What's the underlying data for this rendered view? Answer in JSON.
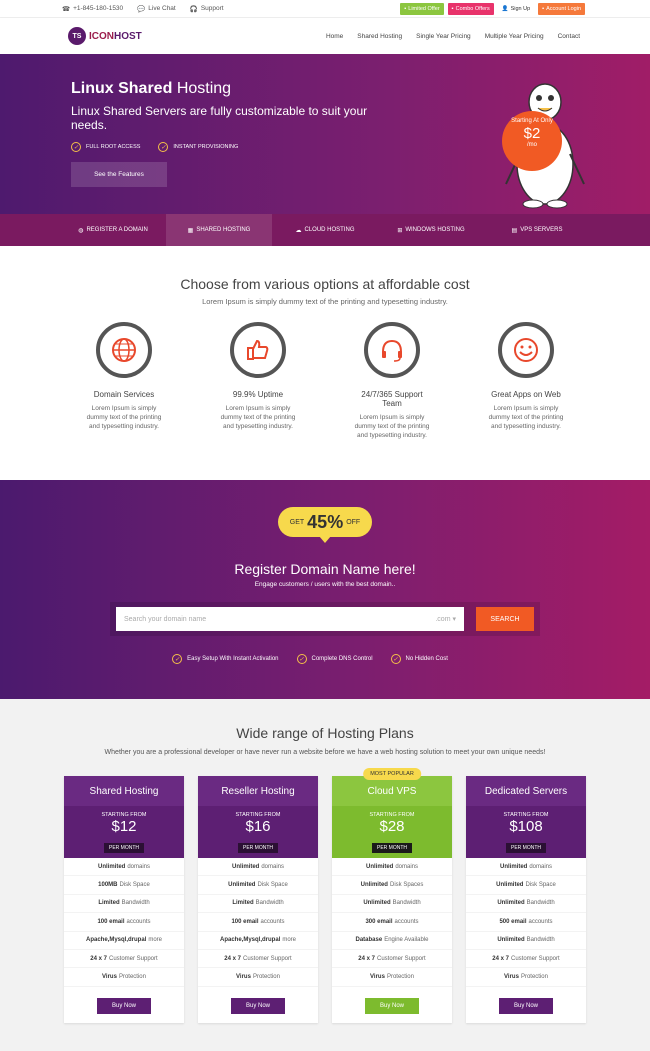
{
  "topbar": {
    "phone": "+1-845-180-1530",
    "chat": "Live Chat",
    "support": "Support",
    "buttons": [
      {
        "label": "Limited Offer",
        "color": "#8cc63f"
      },
      {
        "label": "Combo Offers",
        "color": "#e8336b"
      },
      {
        "label": "Sign Up",
        "color": "#ffffff"
      },
      {
        "label": "Account Login",
        "color": "#f5793b"
      }
    ]
  },
  "nav": {
    "logo_badge": "TS",
    "logo_a": "ICON",
    "logo_b": "HOST",
    "items": [
      "Home",
      "Shared Hosting",
      "Single Year Pricing",
      "Multiple Year Pricing",
      "Contact"
    ]
  },
  "hero": {
    "title_bold": "Linux Shared",
    "title_rest": "Hosting",
    "subtitle": "Linux Shared Servers are fully customizable to suit your needs.",
    "features": [
      "FULL ROOT ACCESS",
      "INSTANT PROVISIONING"
    ],
    "cta": "See the Features",
    "price_label": "Starting At Only",
    "price": "$2",
    "price_unit": "/mo"
  },
  "tabs": [
    {
      "label": "REGISTER A DOMAIN",
      "icon": "globe-icon"
    },
    {
      "label": "SHARED HOSTING",
      "icon": "grid-icon"
    },
    {
      "label": "CLOUD HOSTING",
      "icon": "cloud-icon"
    },
    {
      "label": "WINDOWS HOSTING",
      "icon": "windows-icon"
    },
    {
      "label": "VPS SERVERS",
      "icon": "server-icon"
    }
  ],
  "choose": {
    "title": "Choose from various options at affordable cost",
    "subtitle": "Lorem Ipsum is simply dummy text of the printing and typesetting industry.",
    "features": [
      {
        "title": "Domain Services",
        "icon": "globe-icon",
        "desc": "Lorem Ipsum is simply dummy text of the printing and typesetting industry."
      },
      {
        "title": "99.9% Uptime",
        "icon": "thumbs-up-icon",
        "desc": "Lorem Ipsum is simply dummy text of the printing and typesetting industry."
      },
      {
        "title": "24/7/365 Support Team",
        "icon": "headset-icon",
        "desc": "Lorem Ipsum is simply dummy text of the printing and typesetting industry."
      },
      {
        "title": "Great Apps on Web",
        "icon": "smiley-icon",
        "desc": "Lorem Ipsum is simply dummy text of the printing and typesetting industry."
      }
    ]
  },
  "domain": {
    "get": "GET",
    "percent": "45%",
    "off": "OFF",
    "title": "Register Domain Name here!",
    "subtitle": "Engage customers / users with the best domain..",
    "placeholder": "Search your domain name",
    "tld": ".com",
    "button": "SEARCH",
    "features": [
      "Easy Setup With Instant Activation",
      "Complete DNS Control",
      "No Hidden Cost"
    ]
  },
  "plans": {
    "title": "Wide range of Hosting Plans",
    "subtitle": "Whether you are a professional developer or have never run a website before we have a web hosting solution to meet your own unique needs!",
    "starting": "STARTING FROM",
    "per_month": "PER MONTH",
    "buy": "Buy Now",
    "popular": "MOST POPULAR",
    "cards": [
      {
        "name": "Shared Hosting",
        "price": "$12",
        "rows": [
          [
            "Unlimited",
            "domains"
          ],
          [
            "100MB",
            "Disk Space"
          ],
          [
            "Limited",
            "Bandwidth"
          ],
          [
            "100 email",
            "accounts"
          ],
          [
            "Apache,Mysql,drupal",
            "more"
          ],
          [
            "24 x 7",
            "Customer Support"
          ],
          [
            "Virus",
            "Protection"
          ]
        ]
      },
      {
        "name": "Reseller Hosting",
        "price": "$16",
        "rows": [
          [
            "Unlimited",
            "domains"
          ],
          [
            "Unlimited",
            "Disk Space"
          ],
          [
            "Limited",
            "Bandwidth"
          ],
          [
            "100 email",
            "accounts"
          ],
          [
            "Apache,Mysql,drupal",
            "more"
          ],
          [
            "24 x 7",
            "Customer Support"
          ],
          [
            "Virus",
            "Protection"
          ]
        ]
      },
      {
        "name": "Cloud VPS",
        "price": "$28",
        "rows": [
          [
            "Unlimited",
            "domains"
          ],
          [
            "Unlimited",
            "Disk Spaces"
          ],
          [
            "Unlimited",
            "Bandwidth"
          ],
          [
            "300 email",
            "accounts"
          ],
          [
            "Database",
            "Engine Available"
          ],
          [
            "24 x 7",
            "Customer Support"
          ],
          [
            "Virus",
            "Protection"
          ]
        ]
      },
      {
        "name": "Dedicated Servers",
        "price": "$108",
        "rows": [
          [
            "Unlimited",
            "domains"
          ],
          [
            "Unlimited",
            "Disk Space"
          ],
          [
            "Unlimited",
            "Bandwidth"
          ],
          [
            "500 email",
            "accounts"
          ],
          [
            "Unlimited",
            "Bandwidth"
          ],
          [
            "24 x 7",
            "Customer Support"
          ],
          [
            "Virus",
            "Protection"
          ]
        ]
      }
    ]
  }
}
